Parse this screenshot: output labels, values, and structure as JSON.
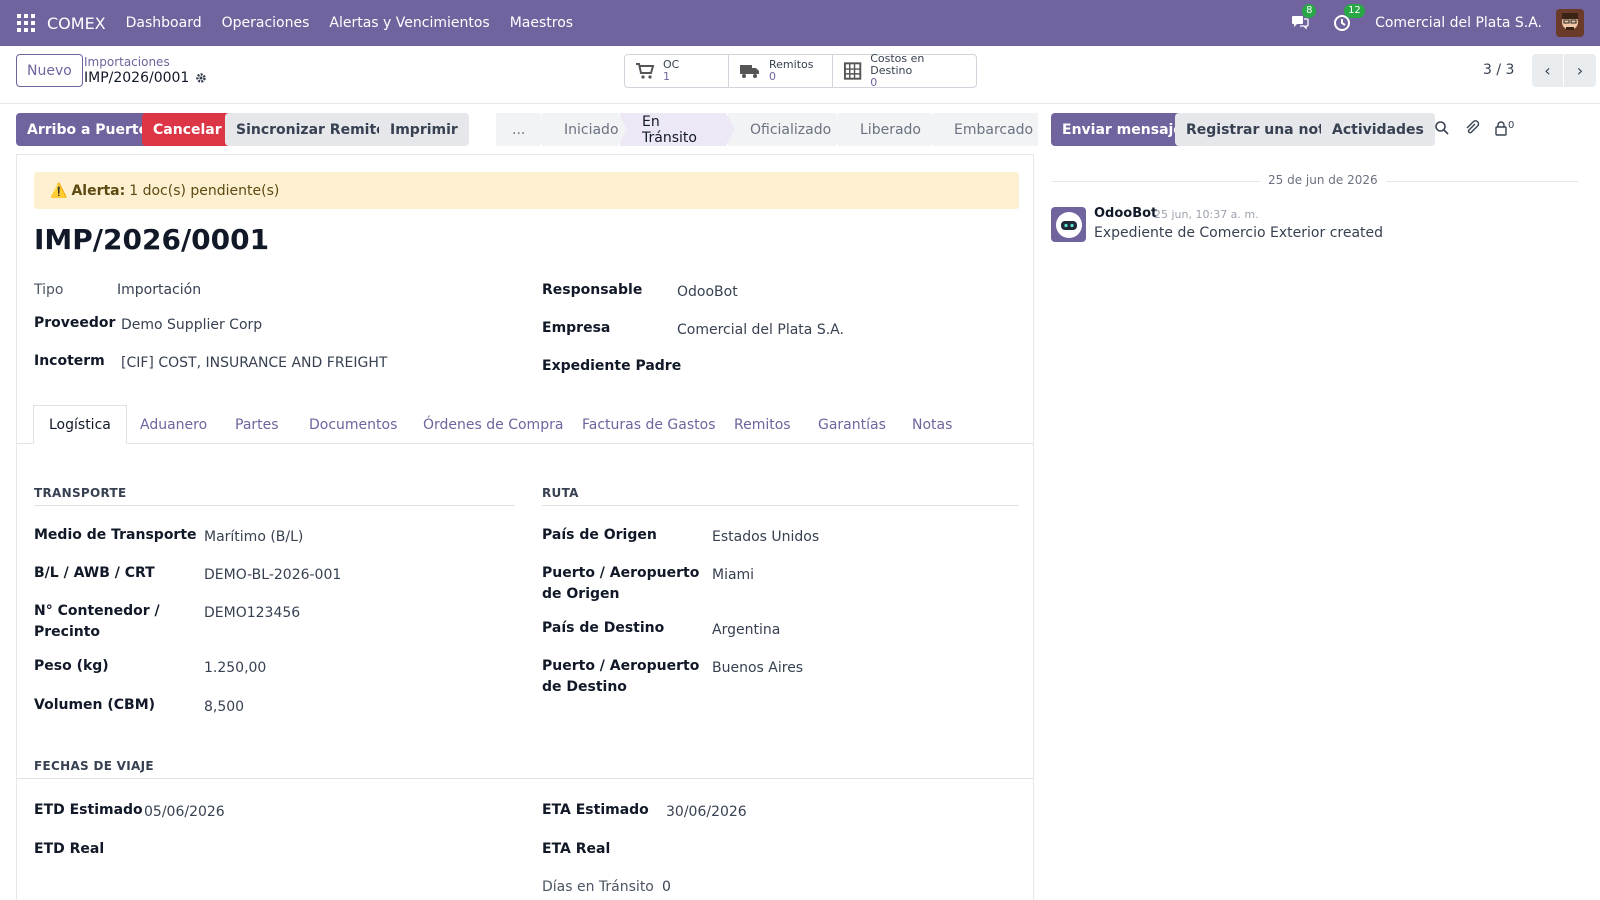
{
  "navbar": {
    "brand": "COMEX",
    "menu": [
      "Dashboard",
      "Operaciones",
      "Alertas y Vencimientos",
      "Maestros"
    ],
    "messages_badge": "8",
    "activities_badge": "12",
    "company": "Comercial del Plata S.A."
  },
  "control_panel": {
    "new_button": "Nuevo",
    "breadcrumb_parent": "Importaciones",
    "breadcrumb_current": "IMP/2026/0001",
    "smart_buttons": [
      {
        "label": "OC",
        "value": "1",
        "icon": "cart-icon"
      },
      {
        "label": "Remitos",
        "value": "0",
        "icon": "truck-icon"
      },
      {
        "label": "Costos en Destino",
        "value": "0",
        "icon": "calculator-icon"
      }
    ],
    "pager": "3 / 3"
  },
  "actions": {
    "arrival": "Arribo a Puerto",
    "cancel": "Cancelar",
    "sync": "Sincronizar Remitos",
    "print": "Imprimir"
  },
  "statusbar": {
    "stages": [
      "...",
      "Iniciado",
      "En Tránsito",
      "Oficializado",
      "Liberado",
      "Embarcado"
    ],
    "active": "En Tránsito"
  },
  "form": {
    "alert_prefix": "Alerta:",
    "alert_text": "1 doc(s) pendiente(s)",
    "title": "IMP/2026/0001",
    "tipo_label": "Tipo",
    "tipo": "Importación",
    "proveedor_label": "Proveedor",
    "proveedor": "Demo Supplier Corp",
    "incoterm_label": "Incoterm",
    "incoterm": "[CIF] COST, INSURANCE AND FREIGHT",
    "responsable_label": "Responsable",
    "responsable": "OdooBot",
    "empresa_label": "Empresa",
    "empresa": "Comercial del Plata S.A.",
    "padre_label": "Expediente Padre"
  },
  "tabs": [
    "Logística",
    "Aduanero",
    "Partes",
    "Documentos",
    "Órdenes de Compra",
    "Facturas de Gastos",
    "Remitos",
    "Garantías",
    "Notas"
  ],
  "transporte": {
    "title": "TRANSPORTE",
    "medio_label": "Medio de Transporte",
    "medio": "Marítimo (B/L)",
    "bl_label": "B/L / AWB / CRT",
    "bl": "DEMO-BL-2026-001",
    "contenedor_label_1": "N° Contenedor /",
    "contenedor_label_2": "Precinto",
    "contenedor": "DEMO123456",
    "peso_label": "Peso (kg)",
    "peso": "1.250,00",
    "volumen_label": "Volumen (CBM)",
    "volumen": "8,500"
  },
  "ruta": {
    "title": "RUTA",
    "pais_origen_label": "País de Origen",
    "pais_origen": "Estados Unidos",
    "puerto_origen_label_1": "Puerto / Aeropuerto",
    "puerto_origen_label_2": "de Origen",
    "puerto_origen": "Miami",
    "pais_destino_label": "País de Destino",
    "pais_destino": "Argentina",
    "puerto_destino_label_1": "Puerto / Aeropuerto",
    "puerto_destino_label_2": "de Destino",
    "puerto_destino": "Buenos Aires"
  },
  "fechas": {
    "title": "FECHAS DE VIAJE",
    "etd_est_label": "ETD Estimado",
    "etd_est": "05/06/2026",
    "etd_real_label": "ETD Real",
    "eta_est_label": "ETA Estimado",
    "eta_est": "30/06/2026",
    "eta_real_label": "ETA Real",
    "dias_label": "Días en Tránsito",
    "dias": "0"
  },
  "chatter": {
    "send": "Enviar mensaje",
    "note": "Registrar una nota",
    "activities": "Actividades",
    "followers": "0",
    "date": "25 de jun de 2026",
    "author": "OdooBot",
    "time": "25 jun, 10:37 a. m.",
    "body": "Expediente de Comercio Exterior created"
  }
}
